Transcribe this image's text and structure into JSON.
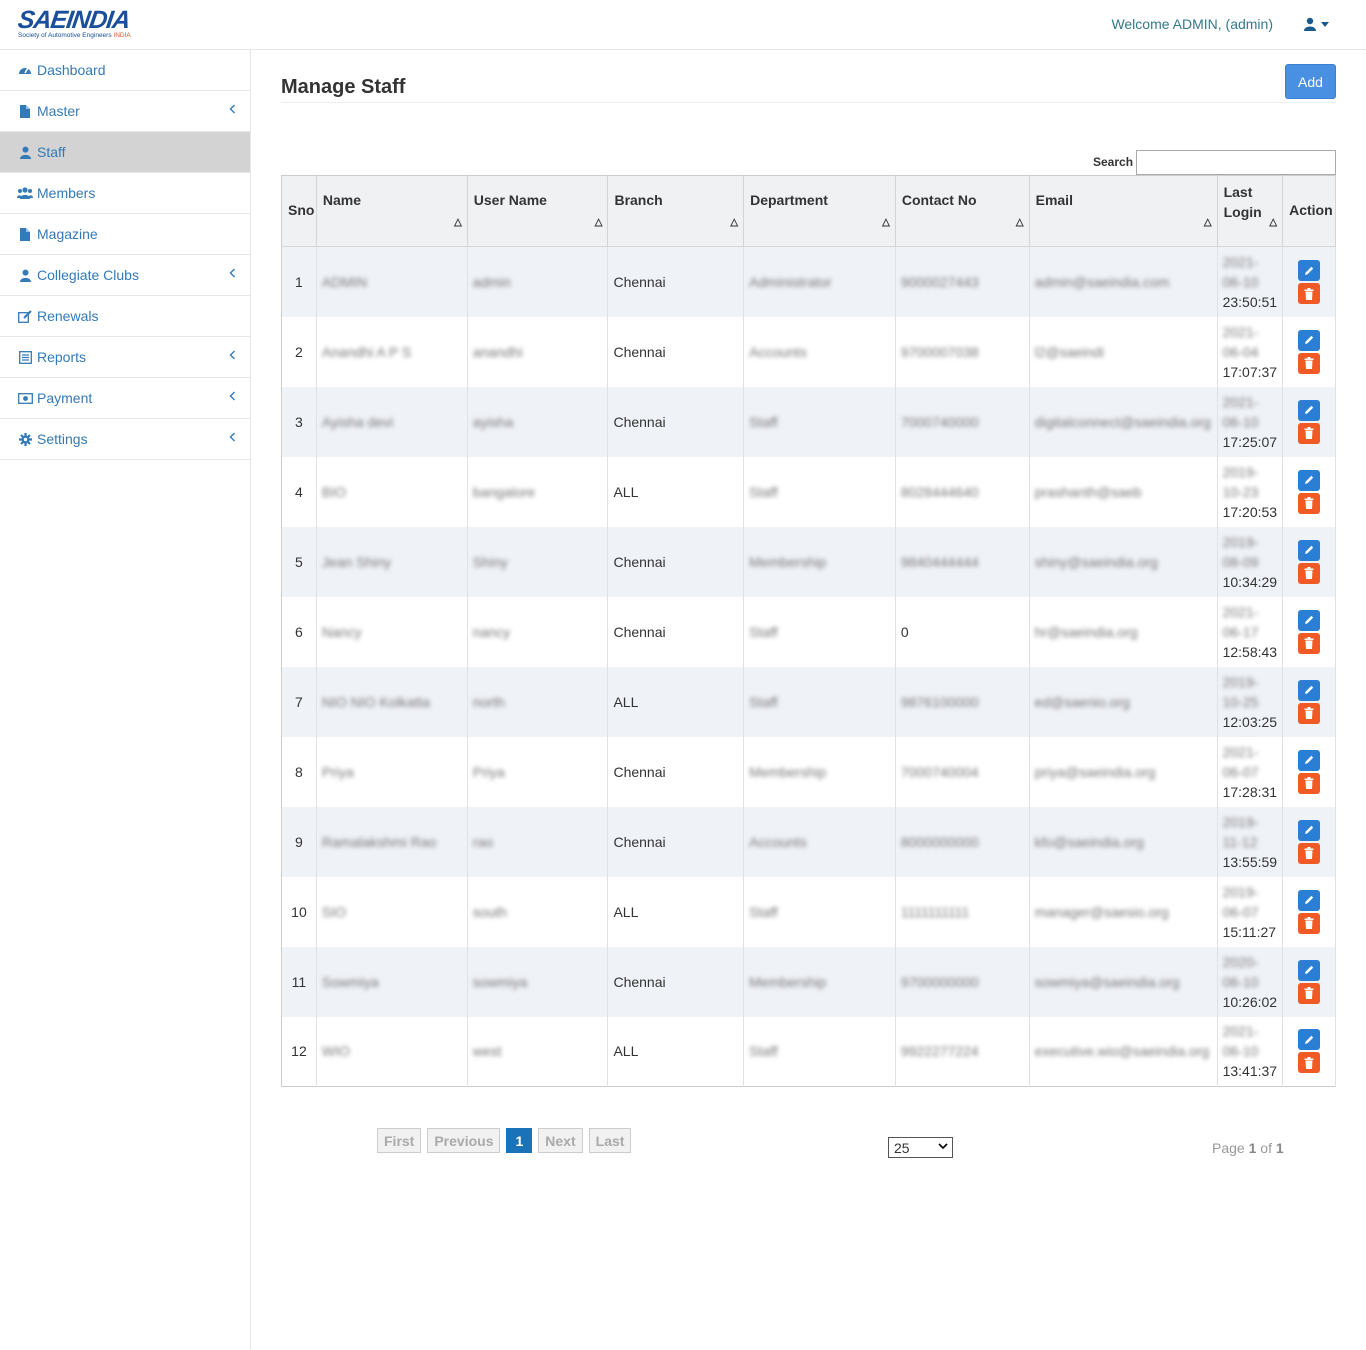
{
  "header": {
    "logo_text": "SAEINDIA",
    "logo_tagline": "Society of Automotive Engineers",
    "logo_tagline_suffix": "INDIA",
    "welcome_text": "Welcome ADMIN, (admin)",
    "user_icon": "user-icon"
  },
  "sidebar": {
    "items": [
      {
        "label": "Dashboard",
        "icon": "dashboard-icon",
        "has_submenu": false
      },
      {
        "label": "Master",
        "icon": "file-icon",
        "has_submenu": true
      },
      {
        "label": "Staff",
        "icon": "user-icon",
        "has_submenu": false,
        "active": true
      },
      {
        "label": "Members",
        "icon": "users-icon",
        "has_submenu": false
      },
      {
        "label": "Magazine",
        "icon": "file-icon",
        "has_submenu": false
      },
      {
        "label": "Collegiate Clubs",
        "icon": "user-icon",
        "has_submenu": true
      },
      {
        "label": "Renewals",
        "icon": "edit-icon",
        "has_submenu": false
      },
      {
        "label": "Reports",
        "icon": "list-icon",
        "has_submenu": true
      },
      {
        "label": "Payment",
        "icon": "money-icon",
        "has_submenu": true
      },
      {
        "label": "Settings",
        "icon": "gear-icon",
        "has_submenu": true
      }
    ]
  },
  "main": {
    "title": "Manage Staff",
    "add_label": "Add",
    "search_label": "Search",
    "search_value": "",
    "columns": [
      "Sno",
      "Name",
      "User Name",
      "Branch",
      "Department",
      "Contact No",
      "Email",
      "Last Login",
      "Action"
    ],
    "rows": [
      {
        "sno": "1",
        "name": "ADMIN",
        "username": "admin",
        "branch": "Chennai",
        "department": "Administrator",
        "contact": "9000027443",
        "email": "admin@saeindia.com",
        "login_date": "2021-",
        "login_md": "06-10",
        "login_time": "23:50:51"
      },
      {
        "sno": "2",
        "name": "Anandhi A P S",
        "username": "anandhi",
        "branch": "Chennai",
        "department": "Accounts",
        "contact": "9700007038",
        "email": "l2@saeindi",
        "login_date": "2021-",
        "login_md": "06-04",
        "login_time": "17:07:37"
      },
      {
        "sno": "3",
        "name": "Ayisha devi",
        "username": "ayisha",
        "branch": "Chennai",
        "department": "Staff",
        "contact": "7000740000",
        "email": "digitalconnect@saeindia.org",
        "login_date": "2021-",
        "login_md": "06-10",
        "login_time": "17:25:07"
      },
      {
        "sno": "4",
        "name": "BIO",
        "username": "bangalore",
        "branch": "ALL",
        "department": "Staff",
        "contact": "8028444640",
        "email": "prashanth@saeb",
        "login_date": "2019-",
        "login_md": "10-23",
        "login_time": "17:20:53"
      },
      {
        "sno": "5",
        "name": "Jean Shiny",
        "username": "Shiny",
        "branch": "Chennai",
        "department": "Membership",
        "contact": "9840444444",
        "email": "shiny@saeindia.org",
        "login_date": "2019-",
        "login_md": "08-09",
        "login_time": "10:34:29"
      },
      {
        "sno": "6",
        "name": "Nancy",
        "username": "nancy",
        "branch": "Chennai",
        "department": "Staff",
        "contact": "0",
        "email": "hr@saeindia.org",
        "login_date": "2021-",
        "login_md": "06-17",
        "login_time": "12:58:43"
      },
      {
        "sno": "7",
        "name": "NIO NIO Kolkatta",
        "username": "north",
        "branch": "ALL",
        "department": "Staff",
        "contact": "9876100000",
        "email": "ed@saenio.org",
        "login_date": "2019-",
        "login_md": "10-25",
        "login_time": "12:03:25"
      },
      {
        "sno": "8",
        "name": "Priya",
        "username": "Priya",
        "branch": "Chennai",
        "department": "Membership",
        "contact": "7000740004",
        "email": "priya@saeindia.org",
        "login_date": "2021-",
        "login_md": "06-07",
        "login_time": "17:28:31"
      },
      {
        "sno": "9",
        "name": "Ramalakshmi Rao",
        "username": "rao",
        "branch": "Chennai",
        "department": "Accounts",
        "contact": "8000000000",
        "email": "kfo@saeindia.org",
        "login_date": "2019-",
        "login_md": "11-12",
        "login_time": "13:55:59"
      },
      {
        "sno": "10",
        "name": "SIO",
        "username": "south",
        "branch": "ALL",
        "department": "Staff",
        "contact": "1111111111",
        "email": "manager@saesio.org",
        "login_date": "2019-",
        "login_md": "06-07",
        "login_time": "15:11:27"
      },
      {
        "sno": "11",
        "name": "Sowmiya",
        "username": "sowmiya",
        "branch": "Chennai",
        "department": "Membership",
        "contact": "9700000000",
        "email": "sowmiya@saeindia.org",
        "login_date": "2020-",
        "login_md": "06-10",
        "login_time": "10:26:02"
      },
      {
        "sno": "12",
        "name": "WIO",
        "username": "west",
        "branch": "ALL",
        "department": "Staff",
        "contact": "9922277224",
        "email": "executive.wio@saeindia.org",
        "login_date": "2021-",
        "login_md": "06-10",
        "login_time": "13:41:37"
      }
    ]
  },
  "pagination": {
    "first": "First",
    "previous": "Previous",
    "current": "1",
    "next": "Next",
    "last": "Last",
    "page_size": "25",
    "page_label": "Page",
    "page_num": "1",
    "of_label": "of",
    "page_total": "1"
  },
  "colors": {
    "link": "#337ab7",
    "add_button": "#4a90e2",
    "edit_button": "#2a7fd4",
    "delete_button": "#f05a24",
    "active_nav": "#d3d3d3"
  }
}
